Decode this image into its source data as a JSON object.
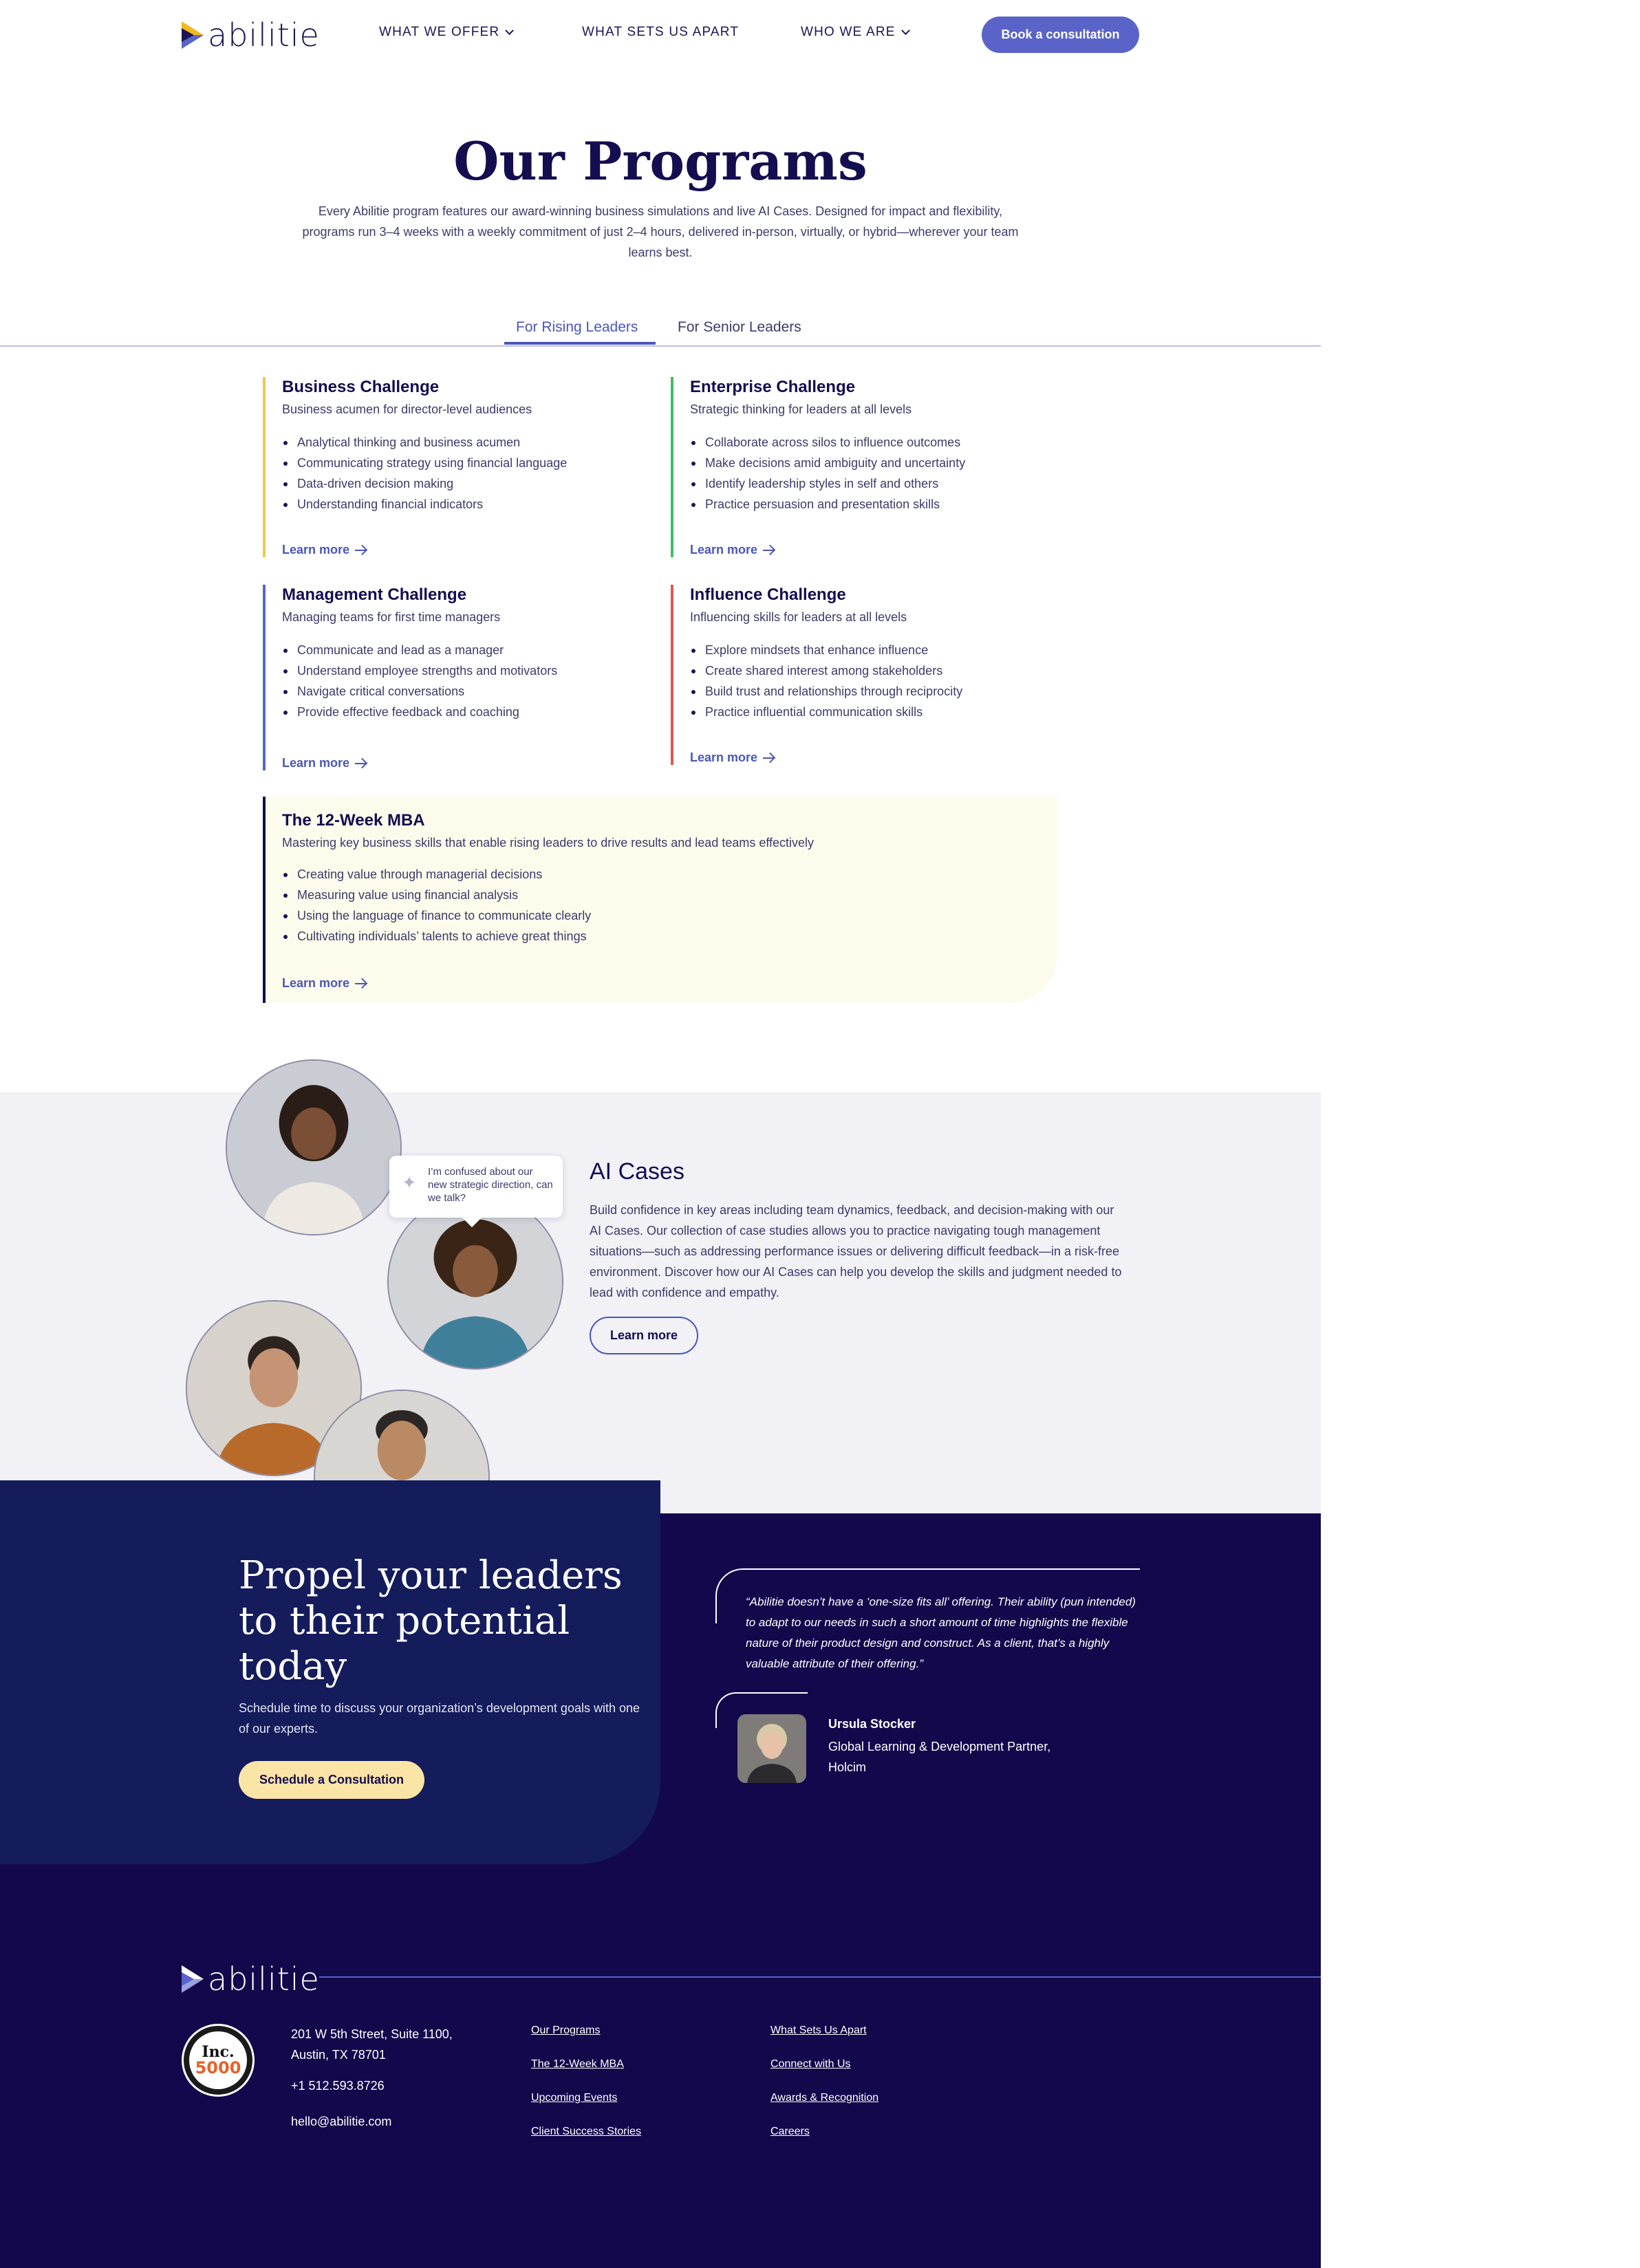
{
  "nav": {
    "logo_text": "abilitie",
    "items": [
      {
        "label": "WHAT WE OFFER"
      },
      {
        "label": "WHAT SETS US APART"
      },
      {
        "label": "WHO WE ARE"
      }
    ],
    "cta": "Book a consultation"
  },
  "hero": {
    "title": "Our Programs",
    "description": "Every Abilitie program features our award-winning business simulations and live AI Cases. Designed for impact and flexibility, programs run 3–4 weeks with a weekly commitment of just 2–4 hours, delivered in-person, virtually, or hybrid—wherever your team learns best."
  },
  "tabs": [
    {
      "label": "For Rising Leaders",
      "active": true
    },
    {
      "label": "For Senior Leaders",
      "active": false
    }
  ],
  "programs": [
    {
      "title": "Business Challenge",
      "subtitle": "Business acumen for director-level audiences",
      "color": "#f2c84b",
      "bullets": [
        "Analytical thinking and business acumen",
        "Communicating strategy using financial language",
        "Data-driven decision making",
        "Understanding financial indicators"
      ],
      "link": "Learn more"
    },
    {
      "title": "Enterprise Challenge",
      "subtitle": "Strategic thinking for leaders at all levels",
      "color": "#3fbf6a",
      "bullets": [
        "Collaborate across silos to influence outcomes",
        "Make decisions amid ambiguity and uncertainty",
        "Identify leadership styles in self and others",
        "Practice persuasion and presentation skills"
      ],
      "link": "Learn more"
    },
    {
      "title": "Management Challenge",
      "subtitle": "Managing teams for first time managers",
      "color": "#5a64c8",
      "bullets": [
        "Communicate and lead as a manager",
        "Understand employee strengths and motivators",
        "Navigate critical conversations",
        "Provide effective feedback and coaching"
      ],
      "link": "Learn more"
    },
    {
      "title": "Influence Challenge",
      "subtitle": "Influencing skills for leaders at all levels",
      "color": "#e2534e",
      "bullets": [
        "Explore mindsets that enhance influence",
        "Create shared interest among stakeholders",
        "Build trust and relationships through reciprocity",
        "Practice influential communication skills"
      ],
      "link": "Learn more"
    },
    {
      "title": "The 12-Week MBA",
      "subtitle": "Mastering key business skills that enable rising leaders to drive results and lead teams effectively",
      "color": "#140d4f",
      "bullets": [
        "Creating value through managerial decisions",
        "Measuring value using financial analysis",
        "Using the language of finance to communicate clearly",
        "Cultivating individuals’ talents to achieve great things"
      ],
      "link": "Learn more"
    }
  ],
  "ai": {
    "bubble": "I’m confused about our new strategic direction, can we talk?",
    "title": "AI Cases",
    "description": "Build confidence in key areas including team dynamics, feedback, and decision-making with our AI Cases. Our collection of case studies allows you to practice navigating tough management situations—such as addressing performance issues or delivering difficult feedback—in a risk-free environment. Discover how our AI Cases can help you develop the skills and judgment needed to lead with confidence and empathy.",
    "button": "Learn more"
  },
  "cta": {
    "title": "Propel your leaders to their potential today",
    "description": "Schedule time to discuss your organization’s development goals with one of our experts.",
    "button": "Schedule a Consultation"
  },
  "testimonial": {
    "quote": "“Abilitie doesn’t have a ‘one-size fits all’ offering. Their ability (pun intended) to adapt to our needs in such a short amount of time highlights the flexible nature of their product design and construct. As a client, that’s a highly valuable attribute of their offering.”",
    "name": "Ursula Stocker",
    "role": "Global Learning & Development Partner, Holcim"
  },
  "footer": {
    "logo_text": "abilitie",
    "badge_top": "Inc.",
    "badge_num": "5000",
    "address": "201 W 5th Street, Suite 1100, Austin, TX 78701",
    "phone": "+1 512.593.8726",
    "email": "hello@abilitie.com",
    "col1": [
      "Our Programs",
      "The 12-Week MBA",
      "Upcoming Events",
      "Client Success Stories"
    ],
    "col2": [
      "What Sets Us Apart",
      "Connect with Us",
      "Awards & Recognition",
      "Careers"
    ]
  }
}
